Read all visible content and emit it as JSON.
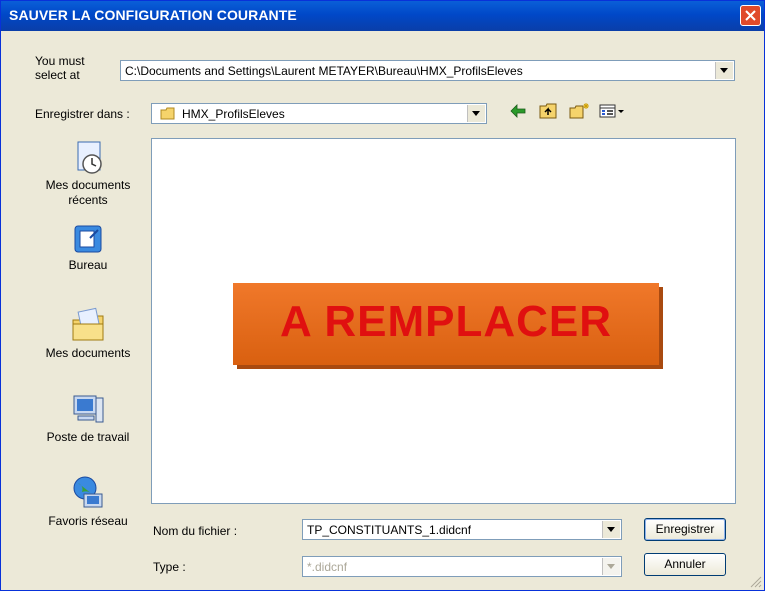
{
  "window": {
    "title": "SAUVER LA CONFIGURATION COURANTE"
  },
  "top_path": {
    "label_line1": "You must",
    "label_line2": "select at",
    "value": "C:\\Documents and Settings\\Laurent METAYER\\Bureau\\HMX_ProfilsEleves"
  },
  "save_in": {
    "label": "Enregistrer dans :",
    "value": "HMX_ProfilsEleves"
  },
  "places": [
    {
      "label_line1": "Mes documents",
      "label_line2": "récents",
      "icon": "recent-documents-icon"
    },
    {
      "label_line1": "Bureau",
      "label_line2": "",
      "icon": "desktop-icon"
    },
    {
      "label_line1": "Mes documents",
      "label_line2": "",
      "icon": "my-documents-icon"
    },
    {
      "label_line1": "Poste de travail",
      "label_line2": "",
      "icon": "my-computer-icon"
    },
    {
      "label_line1": "Favoris réseau",
      "label_line2": "",
      "icon": "network-places-icon"
    }
  ],
  "placeholder_banner": "A REMPLACER",
  "filename": {
    "label": "Nom du fichier :",
    "value": "TP_CONSTITUANTS_1.didcnf"
  },
  "filetype": {
    "label": "Type :",
    "value": "*.didcnf"
  },
  "buttons": {
    "save": "Enregistrer",
    "cancel": "Annuler"
  },
  "colors": {
    "title_bar": "#0048c8",
    "close": "#e04a2a",
    "banner": "#e8701e",
    "banner_text": "#e01010"
  }
}
